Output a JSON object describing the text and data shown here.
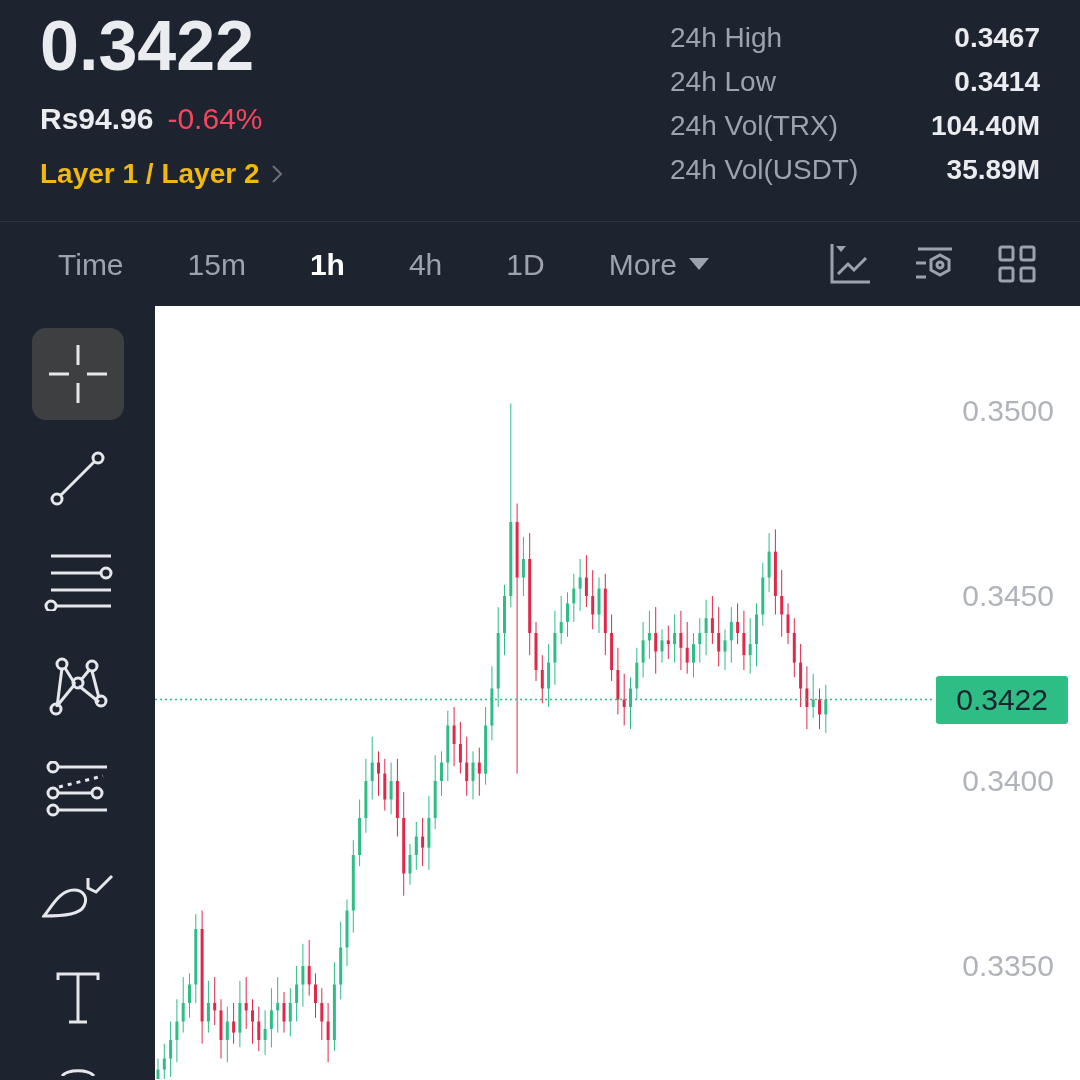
{
  "ticker": {
    "price": "0.3422",
    "fiat_price": "Rs94.96",
    "change": "-0.64%",
    "category": "Layer 1 / Layer 2"
  },
  "stats": [
    {
      "label": "24h High",
      "value": "0.3467"
    },
    {
      "label": "24h Low",
      "value": "0.3414"
    },
    {
      "label": "24h Vol(TRX)",
      "value": "104.40M"
    },
    {
      "label": "24h Vol(USDT)",
      "value": "35.89M"
    }
  ],
  "intervals": [
    {
      "label": "Time",
      "selected": false
    },
    {
      "label": "15m",
      "selected": false
    },
    {
      "label": "1h",
      "selected": true
    },
    {
      "label": "4h",
      "selected": false
    },
    {
      "label": "1D",
      "selected": false
    },
    {
      "label": "More",
      "selected": false,
      "dropdown": true
    }
  ],
  "tools": [
    {
      "kind": "crosshair",
      "selected": true
    },
    {
      "kind": "line",
      "selected": false
    },
    {
      "kind": "levels",
      "selected": false
    },
    {
      "kind": "pattern",
      "selected": false
    },
    {
      "kind": "channel",
      "selected": false
    },
    {
      "kind": "brush",
      "selected": false
    },
    {
      "kind": "text",
      "selected": false
    },
    {
      "kind": "partial",
      "selected": false
    }
  ],
  "chart": {
    "price_axis": [
      {
        "label": "0.3500"
      },
      {
        "label": "0.3450"
      },
      {
        "label": "0.3400"
      },
      {
        "label": "0.3350"
      }
    ],
    "last_price": {
      "label": "0.3422"
    }
  }
}
